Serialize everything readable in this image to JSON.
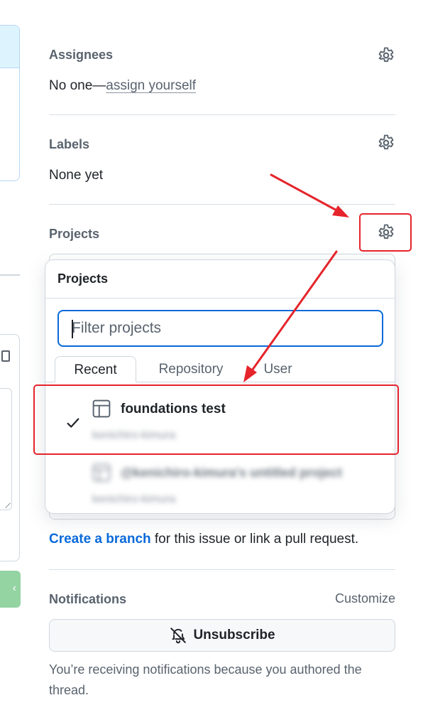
{
  "assignees": {
    "title": "Assignees",
    "prefix": "No one—",
    "assign_link": "assign yourself"
  },
  "labels": {
    "title": "Labels",
    "value": "None yet"
  },
  "projects": {
    "title": "Projects"
  },
  "dropdown": {
    "title": "Projects",
    "filter_placeholder": "Filter projects",
    "tabs": [
      "Recent",
      "Repository",
      "User"
    ],
    "active_tab": "Recent",
    "items": [
      {
        "name": "foundations test",
        "owner": "kenichiro-kimura",
        "selected": true
      },
      {
        "name": "@kenichiro-kimura's untitled project",
        "owner": "kenichiro-kimura",
        "selected": false
      }
    ]
  },
  "development": {
    "link": "Create a branch",
    "suffix": " for this issue or link a pull request."
  },
  "notifications": {
    "title": "Notifications",
    "customize": "Customize",
    "unsubscribe_label": "Unsubscribe",
    "notice": "You’re receiving notifications because you authored the thread."
  },
  "annotations": {
    "color": "#e5242b"
  },
  "colors": {
    "link": "#0969da",
    "focus": "#0969da",
    "muted": "#59636e"
  }
}
